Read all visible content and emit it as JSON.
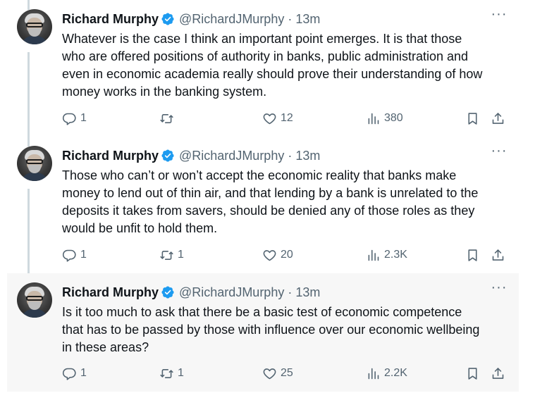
{
  "tweets": [
    {
      "author": {
        "name": "Richard Murphy",
        "handle": "@RichardJMurphy",
        "verified": true
      },
      "time": "13m",
      "text": "Whatever is the case I think an important point emerges. It is that those\nwho are offered positions of authority in banks, public administration and\neven in economic academia really should prove their understanding of how\nmoney works in the banking system.",
      "stats": {
        "replies": "1",
        "retweets": "",
        "likes": "12",
        "views": "380"
      }
    },
    {
      "author": {
        "name": "Richard Murphy",
        "handle": "@RichardJMurphy",
        "verified": true
      },
      "time": "13m",
      "text": "Those who can’t or won’t accept the economic reality that banks make\nmoney to lend out of thin air, and that lending by a bank is unrelated to the\ndeposits it takes from savers, should be denied any of those roles as they\nwould be unfit to hold them.",
      "stats": {
        "replies": "1",
        "retweets": "1",
        "likes": "20",
        "views": "2.3K"
      }
    },
    {
      "author": {
        "name": "Richard Murphy",
        "handle": "@RichardJMurphy",
        "verified": true
      },
      "time": "13m",
      "text": "Is it too much to ask that there be a basic test of economic competence\nthat has to be passed by those with influence over our economic wellbeing\nin these areas?",
      "stats": {
        "replies": "1",
        "retweets": "1",
        "likes": "25",
        "views": "2.2K"
      }
    }
  ],
  "separator": "·",
  "more_glyph": "···",
  "icons": {
    "reply": "reply-icon",
    "retweet": "retweet-icon",
    "like": "heart-icon",
    "views": "views-icon",
    "bookmark": "bookmark-icon",
    "share": "share-icon",
    "verified": "verified-badge-icon",
    "more": "more-options-icon"
  },
  "colors": {
    "text_primary": "#0f1419",
    "text_secondary": "#536471",
    "verified_blue": "#1d9bf0",
    "thread_line": "#cfd9de",
    "highlight_background": "#f7f7f7"
  }
}
